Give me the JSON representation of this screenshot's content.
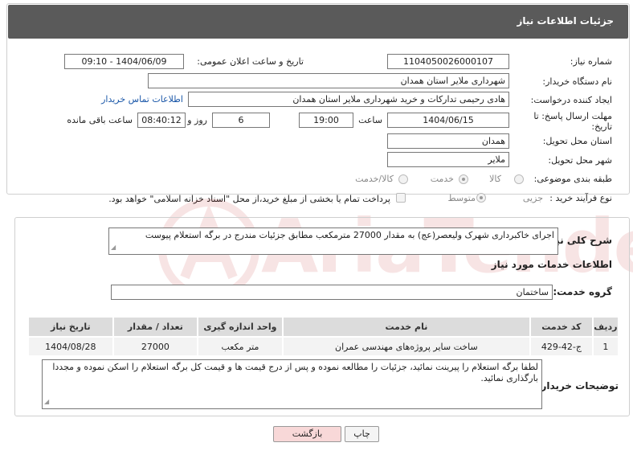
{
  "header": {
    "title": "جزئیات اطلاعات نیاز"
  },
  "form": {
    "need_number_label": "شماره نیاز:",
    "need_number": "1104050026000107",
    "announce_label": "تاریخ و ساعت اعلان عمومی:",
    "announce_value": "1404/06/09 - 09:10",
    "buyer_org_label": "نام دستگاه خریدار:",
    "buyer_org": "شهرداری ملایر استان همدان",
    "creator_label": "ایجاد کننده درخواست:",
    "creator": "هادی رحیمی تدارکات و خرید شهرداری ملایر استان همدان",
    "contact_link": "اطلاعات تماس خریدار",
    "deadline_label": "مهلت ارسال پاسخ: تا تاریخ:",
    "deadline_date": "1404/06/15",
    "time_label": "ساعت",
    "deadline_time": "19:00",
    "days_value": "6",
    "days_label": "روز و",
    "remaining_time": "08:40:12",
    "remaining_label": "ساعت باقی مانده",
    "province_label": "استان محل تحویل:",
    "province": "همدان",
    "city_label": "شهر محل تحویل:",
    "city": "ملایر",
    "category_label": "طبقه بندی موضوعی:",
    "category_options": [
      "کالا",
      "خدمت",
      "کالا/خدمت"
    ],
    "category_selected": "خدمت",
    "process_label": "نوع فرآیند خرید :",
    "process_options": [
      "جزیی",
      "متوسط"
    ],
    "process_selected": "جزیی",
    "payment_note": "پرداخت تمام یا بخشی از مبلغ خرید،از محل \"اسناد خزانه اسلامی\" خواهد بود."
  },
  "details": {
    "summary_label": "شرح کلی نیاز:",
    "summary_text": "اجرای خاکبرداری شهرک ولیعصر(عج) به مقدار 27000 مترمکعب مطابق جزئیات مندرج در برگه استعلام پیوست",
    "services_title": "اطلاعات خدمات مورد نیاز",
    "service_group_label": "گروه خدمت:",
    "service_group": "ساختمان",
    "table": {
      "headers": [
        "ردیف",
        "کد خدمت",
        "نام خدمت",
        "واحد اندازه گیری",
        "تعداد / مقدار",
        "تاریخ نیاز"
      ],
      "rows": [
        [
          "1",
          "ج-42-429",
          "ساخت سایر پروژه‌های مهندسی عمران",
          "متر مکعب",
          "27000",
          "1404/08/28"
        ]
      ]
    },
    "buyer_notes_label": "توضیحات خریدار:",
    "buyer_notes": "لطفا برگه استعلام را پیرینت نمائید، جزئیات را مطالعه نموده و پس از درج قیمت ها و قیمت کل برگه استعلام را اسکن نموده و مجددا بارگذاری نمائید."
  },
  "buttons": {
    "print": "چاپ",
    "back": "بازگشت"
  },
  "watermark": {
    "text": "AriaTender.neT"
  },
  "colors": {
    "header_bg": "#5a5a5a",
    "link": "#1a57a8",
    "back_button_bg": "#f8d8d8",
    "table_header_bg": "#dcdcdc",
    "watermark": "#b00000"
  }
}
